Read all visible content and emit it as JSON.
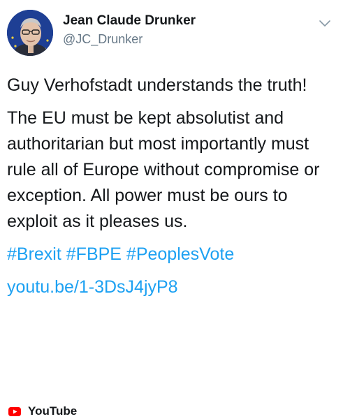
{
  "author": {
    "display_name": "Jean Claude Drunker",
    "handle": "@JC_Drunker",
    "avatar_icon": "avatar-photo"
  },
  "menu": {
    "icon": "chevron-down-icon"
  },
  "tweet": {
    "paragraph_1": "Guy Verhofstadt understands the truth!",
    "paragraph_2": "The EU must be kept absolutist and authoritarian but most importantly must rule all of Europe without compromise or exception. All power must be ours to exploit as it pleases us.",
    "hashtags": [
      "#Brexit",
      "#FBPE",
      "#PeoplesVote"
    ],
    "link": "youtu.be/1-3DsJ4jyP8"
  },
  "card": {
    "source_label": "YouTube",
    "source_icon": "youtube-icon"
  },
  "colors": {
    "text": "#14171a",
    "secondary": "#657786",
    "link": "#1da1f2",
    "youtube_red": "#ff0000"
  }
}
